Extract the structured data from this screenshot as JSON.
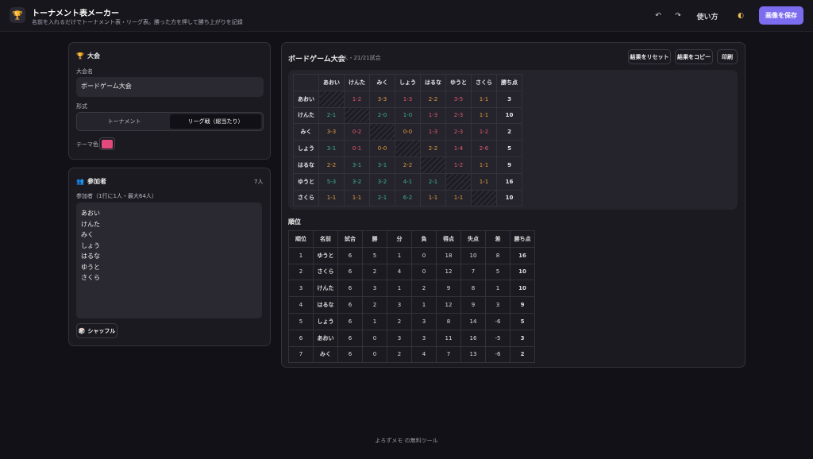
{
  "header": {
    "logo_icon": "🏆",
    "title": "トーナメント表メーカー",
    "subtitle": "名前を入れるだけでトーナメント表・リーグ表。勝った方を押して勝ち上がりを記録",
    "undo_icon": "↶",
    "redo_icon": "↷",
    "help_label": "使い方",
    "theme_icon": "◐",
    "save_label": "画像を保存"
  },
  "settings": {
    "icon": "🏆",
    "title": "大会",
    "name_label": "大会名",
    "name_value": "ボードゲーム大会",
    "format_label": "形式",
    "format_options": [
      "トーナメント",
      "リーグ戦（総当たり）"
    ],
    "theme_label": "テーマ色",
    "theme_color": "#e24a7b"
  },
  "participants": {
    "icon": "👥",
    "title": "参加者",
    "count": "7人",
    "hint": "参加者（1行に1人・最大64人）",
    "names": [
      "あおい",
      "けんた",
      "みく",
      "しょう",
      "はるな",
      "ゆうと",
      "さくら"
    ],
    "shuffle_icon": "🎲",
    "shuffle_label": "シャッフル"
  },
  "league": {
    "title": "ボードゲーム大会",
    "meta": "7人・21/21試合",
    "reset_label": "結果をリセット",
    "copy_label": "結果をコピー",
    "print_label": "印刷",
    "matrix": {
      "columns": [
        "あおい",
        "けんた",
        "みく",
        "しょう",
        "はるな",
        "ゆうと",
        "さくら",
        "勝ち点"
      ],
      "rows": [
        {
          "name": "あおい",
          "cells": [
            [
              "",
              ""
            ],
            [
              "1-2",
              "L"
            ],
            [
              "3-3",
              "D"
            ],
            [
              "1-3",
              "L"
            ],
            [
              "2-2",
              "D"
            ],
            [
              "3-5",
              "L"
            ],
            [
              "1-1",
              "D"
            ]
          ],
          "points": "3"
        },
        {
          "name": "けんた",
          "cells": [
            [
              "2-1",
              "W"
            ],
            [
              "",
              ""
            ],
            [
              "2-0",
              "W"
            ],
            [
              "1-0",
              "W"
            ],
            [
              "1-3",
              "L"
            ],
            [
              "2-3",
              "L"
            ],
            [
              "1-1",
              "D"
            ]
          ],
          "points": "10"
        },
        {
          "name": "みく",
          "cells": [
            [
              "3-3",
              "D"
            ],
            [
              "0-2",
              "L"
            ],
            [
              "",
              ""
            ],
            [
              "0-0",
              "D"
            ],
            [
              "1-3",
              "L"
            ],
            [
              "2-3",
              "L"
            ],
            [
              "1-2",
              "L"
            ]
          ],
          "points": "2"
        },
        {
          "name": "しょう",
          "cells": [
            [
              "3-1",
              "W"
            ],
            [
              "0-1",
              "L"
            ],
            [
              "0-0",
              "D"
            ],
            [
              "",
              ""
            ],
            [
              "2-2",
              "D"
            ],
            [
              "1-4",
              "L"
            ],
            [
              "2-6",
              "L"
            ]
          ],
          "points": "5"
        },
        {
          "name": "はるな",
          "cells": [
            [
              "2-2",
              "D"
            ],
            [
              "3-1",
              "W"
            ],
            [
              "3-1",
              "W"
            ],
            [
              "2-2",
              "D"
            ],
            [
              "",
              ""
            ],
            [
              "1-2",
              "L"
            ],
            [
              "1-1",
              "D"
            ]
          ],
          "points": "9"
        },
        {
          "name": "ゆうと",
          "cells": [
            [
              "5-3",
              "W"
            ],
            [
              "3-2",
              "W"
            ],
            [
              "3-2",
              "W"
            ],
            [
              "4-1",
              "W"
            ],
            [
              "2-1",
              "W"
            ],
            [
              "",
              ""
            ],
            [
              "1-1",
              "D"
            ]
          ],
          "points": "16"
        },
        {
          "name": "さくら",
          "cells": [
            [
              "1-1",
              "D"
            ],
            [
              "1-1",
              "D"
            ],
            [
              "2-1",
              "W"
            ],
            [
              "6-2",
              "W"
            ],
            [
              "1-1",
              "D"
            ],
            [
              "1-1",
              "D"
            ],
            [
              "",
              ""
            ]
          ],
          "points": "10"
        }
      ]
    },
    "standings": {
      "title": "順位",
      "columns": [
        "順位",
        "名前",
        "試合",
        "勝",
        "分",
        "負",
        "得点",
        "失点",
        "差",
        "勝ち点"
      ],
      "rows": [
        [
          "1",
          "ゆうと",
          "6",
          "5",
          "1",
          "0",
          "18",
          "10",
          "8",
          "16"
        ],
        [
          "2",
          "さくら",
          "6",
          "2",
          "4",
          "0",
          "12",
          "7",
          "5",
          "10"
        ],
        [
          "3",
          "けんた",
          "6",
          "3",
          "1",
          "2",
          "9",
          "8",
          "1",
          "10"
        ],
        [
          "4",
          "はるな",
          "6",
          "2",
          "3",
          "1",
          "12",
          "9",
          "3",
          "9"
        ],
        [
          "5",
          "しょう",
          "6",
          "1",
          "2",
          "3",
          "8",
          "14",
          "-6",
          "5"
        ],
        [
          "6",
          "あおい",
          "6",
          "0",
          "3",
          "3",
          "11",
          "16",
          "-5",
          "3"
        ],
        [
          "7",
          "みく",
          "6",
          "0",
          "2",
          "4",
          "7",
          "13",
          "-6",
          "2"
        ]
      ]
    }
  },
  "footer": {
    "text": "よろずメモ の無料ツール"
  },
  "colors": {
    "accent": "#7c6cf0",
    "win": "#3bb387",
    "loss": "#e0586a",
    "draw": "#e39a3c"
  }
}
